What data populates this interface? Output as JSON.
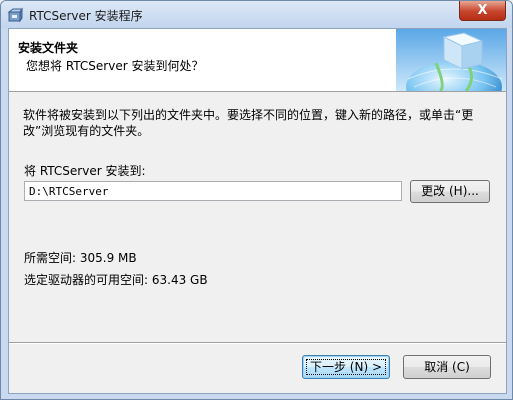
{
  "window": {
    "title": "RTCServer 安装程序",
    "close_symbol": "X"
  },
  "header": {
    "title": "安装文件夹",
    "subtitle": "您想将 RTCServer 安装到何处？"
  },
  "body": {
    "description": "软件将被安装到以下列出的文件夹中。要选择不同的位置，键入新的路径，或单击“更改”浏览现有的文件夹。",
    "destination_label": "将 RTCServer 安装到:",
    "destination_path": "D:\\RTCServer",
    "browse_label": "更改 (H)...",
    "space_required": "所需空间: 305.9 MB",
    "space_available": "选定驱动器的可用空间: 63.43 GB"
  },
  "footer": {
    "next_label": "下一步 (N) >",
    "cancel_label": "取消 (C)"
  },
  "icons": {
    "app": "installer-package-icon",
    "header": "installer-globe-cube-icon",
    "close": "close-icon"
  },
  "colors": {
    "close_button": "#c7442c",
    "frame": "#c9daf0",
    "dialog_bg": "#f0f0f0",
    "header_bg": "#ffffff",
    "default_button_border": "#3c7fb1"
  }
}
